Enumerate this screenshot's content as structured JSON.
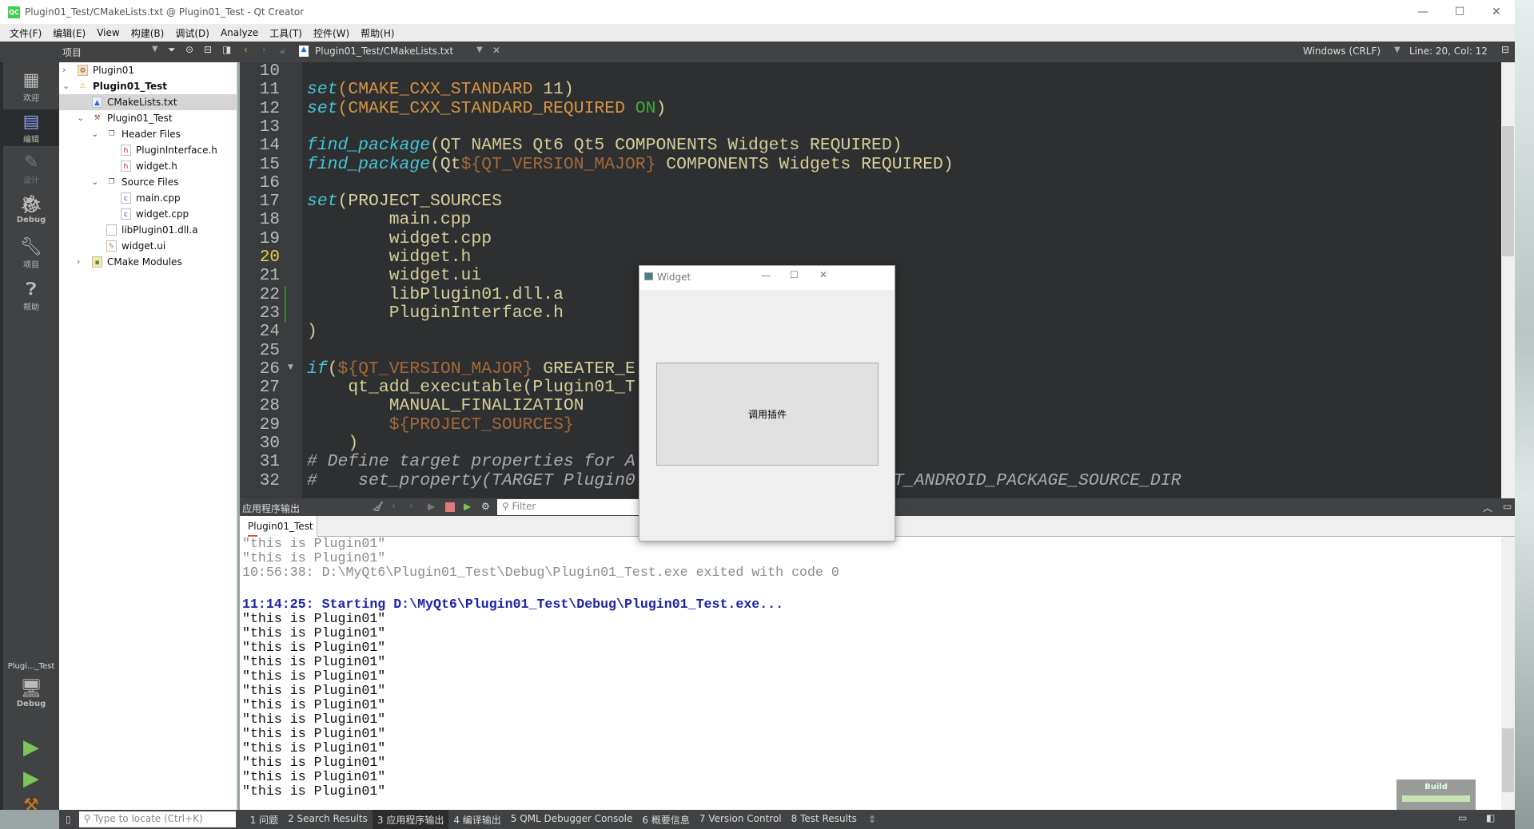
{
  "window": {
    "title": "Plugin01_Test/CMakeLists.txt @ Plugin01_Test - Qt Creator",
    "logo": "QC"
  },
  "menu": [
    "文件(F)",
    "编辑(E)",
    "View",
    "构建(B)",
    "调试(D)",
    "Analyze",
    "工具(T)",
    "控件(W)",
    "帮助(H)"
  ],
  "toolbar": {
    "panel": "项目",
    "file": "Plugin01_Test/CMakeLists.txt",
    "line_ending": "Windows (CRLF)",
    "position": "Line: 20, Col: 12"
  },
  "modes": [
    {
      "label": "欢迎",
      "icon": "grid-icon"
    },
    {
      "label": "编辑",
      "icon": "edit-icon",
      "active": true
    },
    {
      "label": "设计",
      "icon": "pencil-icon"
    },
    {
      "label": "Debug",
      "icon": "bug-icon"
    },
    {
      "label": "项目",
      "icon": "wrench-icon"
    },
    {
      "label": "帮助",
      "icon": "help-icon"
    }
  ],
  "target": {
    "name": "Plugi..._Test",
    "config": "Debug"
  },
  "tree": [
    {
      "label": "Plugin01",
      "level": 0,
      "arrow": "›",
      "icon": "project-icon"
    },
    {
      "label": "Plugin01_Test",
      "level": 0,
      "arrow": "⌄",
      "icon": "warning-icon",
      "bold": true
    },
    {
      "label": "CMakeLists.txt",
      "level": 1,
      "icon": "cmake-icon",
      "selected": true
    },
    {
      "label": "Plugin01_Test",
      "level": 1,
      "arrow": "⌄",
      "icon": "hammer-icon"
    },
    {
      "label": "Header Files",
      "level": 2,
      "arrow": "⌄",
      "icon": "folder-icon"
    },
    {
      "label": "PluginInterface.h",
      "level": 3,
      "icon": "header-file-icon"
    },
    {
      "label": "widget.h",
      "level": 3,
      "icon": "header-file-icon"
    },
    {
      "label": "Source Files",
      "level": 2,
      "arrow": "⌄",
      "icon": "folder-icon"
    },
    {
      "label": "main.cpp",
      "level": 3,
      "icon": "cpp-file-icon"
    },
    {
      "label": "widget.cpp",
      "level": 3,
      "icon": "cpp-file-icon"
    },
    {
      "label": "libPlugin01.dll.a",
      "level": 2,
      "icon": "file-icon"
    },
    {
      "label": "widget.ui",
      "level": 2,
      "icon": "ui-file-icon"
    },
    {
      "label": "CMake Modules",
      "level": 1,
      "arrow": "›",
      "icon": "cmake-modules-icon"
    }
  ],
  "editor": {
    "current_line": 20,
    "lines": [
      {
        "n": 10,
        "t": []
      },
      {
        "n": 11,
        "t": [
          [
            "set",
            "kw"
          ],
          [
            "(",
            "arg"
          ],
          [
            "CMAKE_CXX_STANDARD ",
            "arg"
          ],
          [
            "11)",
            "pn"
          ]
        ]
      },
      {
        "n": 12,
        "t": [
          [
            "set",
            "kw"
          ],
          [
            "(CMAKE_CXX_STANDARD_REQUIRED ",
            "arg"
          ],
          [
            "ON",
            "on"
          ],
          [
            ")",
            "pn"
          ]
        ]
      },
      {
        "n": 13,
        "t": []
      },
      {
        "n": 14,
        "t": [
          [
            "find_package",
            "kw"
          ],
          [
            "(QT NAMES Qt6 Qt5 COMPONENTS Widgets REQUIRED)",
            "plain"
          ]
        ]
      },
      {
        "n": 15,
        "t": [
          [
            "find_package",
            "kw"
          ],
          [
            "(Qt",
            "plain"
          ],
          [
            "${QT_VERSION_MAJOR}",
            "var"
          ],
          [
            " COMPONENTS Widgets REQUIRED)",
            "plain"
          ]
        ]
      },
      {
        "n": 16,
        "t": []
      },
      {
        "n": 17,
        "t": [
          [
            "set",
            "kw"
          ],
          [
            "(PROJECT_SOURCES",
            "plain"
          ]
        ]
      },
      {
        "n": 18,
        "t": [
          [
            "        main.cpp",
            "plain"
          ]
        ]
      },
      {
        "n": 19,
        "t": [
          [
            "        widget.cpp",
            "plain"
          ]
        ]
      },
      {
        "n": 20,
        "t": [
          [
            "        widget.h",
            "plain"
          ]
        ]
      },
      {
        "n": 21,
        "t": [
          [
            "        widget.ui",
            "plain"
          ]
        ]
      },
      {
        "n": 22,
        "t": [
          [
            "        libPlugin01.dll.a",
            "plain"
          ]
        ]
      },
      {
        "n": 23,
        "t": [
          [
            "        PluginInterface.h",
            "plain"
          ]
        ]
      },
      {
        "n": 24,
        "t": [
          [
            ")",
            "plain"
          ]
        ]
      },
      {
        "n": 25,
        "t": []
      },
      {
        "n": 26,
        "t": [
          [
            "if",
            "kw"
          ],
          [
            "(",
            "plain"
          ],
          [
            "${QT_VERSION_MAJOR}",
            "var"
          ],
          [
            " GREATER_E",
            "plain"
          ]
        ]
      },
      {
        "n": 27,
        "t": [
          [
            "    qt_add_executable(Plugin01_T",
            "plain"
          ]
        ]
      },
      {
        "n": 28,
        "t": [
          [
            "        MANUAL_FINALIZATION",
            "plain"
          ]
        ]
      },
      {
        "n": 29,
        "t": [
          [
            "        ${PROJECT_SOURCES}",
            "var"
          ]
        ]
      },
      {
        "n": 30,
        "t": [
          [
            "    )",
            "plain"
          ]
        ]
      },
      {
        "n": 31,
        "t": [
          [
            "# Define target properties for A",
            "cm"
          ]
        ]
      },
      {
        "n": 32,
        "t": [
          [
            "#    set_property(TARGET Plugin0",
            "cm"
          ]
        ]
      }
    ],
    "line32_tail": "T_ANDROID_PACKAGE_SOURCE_DIR"
  },
  "output": {
    "title": "应用程序输出",
    "filter_placeholder": "Filter",
    "tab": "Plugin01_Test",
    "lines": [
      {
        "text": "\"this is Plugin01\"",
        "color": "#8a8a8a"
      },
      {
        "text": "\"this is Plugin01\"",
        "color": "#8a8a8a"
      },
      {
        "text": "10:56:38: D:\\MyQt6\\Plugin01_Test\\Debug\\Plugin01_Test.exe exited with code 0",
        "color": "#8a8a8a"
      },
      {
        "text": "",
        "color": "#000"
      },
      {
        "text": "11:14:25: Starting D:\\MyQt6\\Plugin01_Test\\Debug\\Plugin01_Test.exe...",
        "color": "#1b22a8",
        "bold": true
      },
      {
        "text": "\"this is Plugin01\"",
        "color": "#111"
      },
      {
        "text": "\"this is Plugin01\"",
        "color": "#111"
      },
      {
        "text": "\"this is Plugin01\"",
        "color": "#111"
      },
      {
        "text": "\"this is Plugin01\"",
        "color": "#111"
      },
      {
        "text": "\"this is Plugin01\"",
        "color": "#111"
      },
      {
        "text": "\"this is Plugin01\"",
        "color": "#111"
      },
      {
        "text": "\"this is Plugin01\"",
        "color": "#111"
      },
      {
        "text": "\"this is Plugin01\"",
        "color": "#111"
      },
      {
        "text": "\"this is Plugin01\"",
        "color": "#111"
      },
      {
        "text": "\"this is Plugin01\"",
        "color": "#111"
      },
      {
        "text": "\"this is Plugin01\"",
        "color": "#111"
      },
      {
        "text": "\"this is Plugin01\"",
        "color": "#111"
      },
      {
        "text": "\"this is Plugin01\"",
        "color": "#111"
      }
    ]
  },
  "status": {
    "locate_placeholder": "Type to locate (Ctrl+K)",
    "panes": [
      "1 问题",
      "2 Search Results",
      "3 应用程序输出",
      "4 编译输出",
      "5 QML Debugger Console",
      "6 概要信息",
      "7 Version Control",
      "8 Test Results"
    ],
    "active_pane": 2,
    "build_label": "Build",
    "build_progress": 1.0
  },
  "widget": {
    "title": "Widget",
    "button": "调用插件"
  },
  "colors": {
    "accent_green": "#41cd52",
    "keyword": "#45c6d6",
    "editor_bg": "#2e2f30",
    "build_progress": "#c8e2b0"
  }
}
